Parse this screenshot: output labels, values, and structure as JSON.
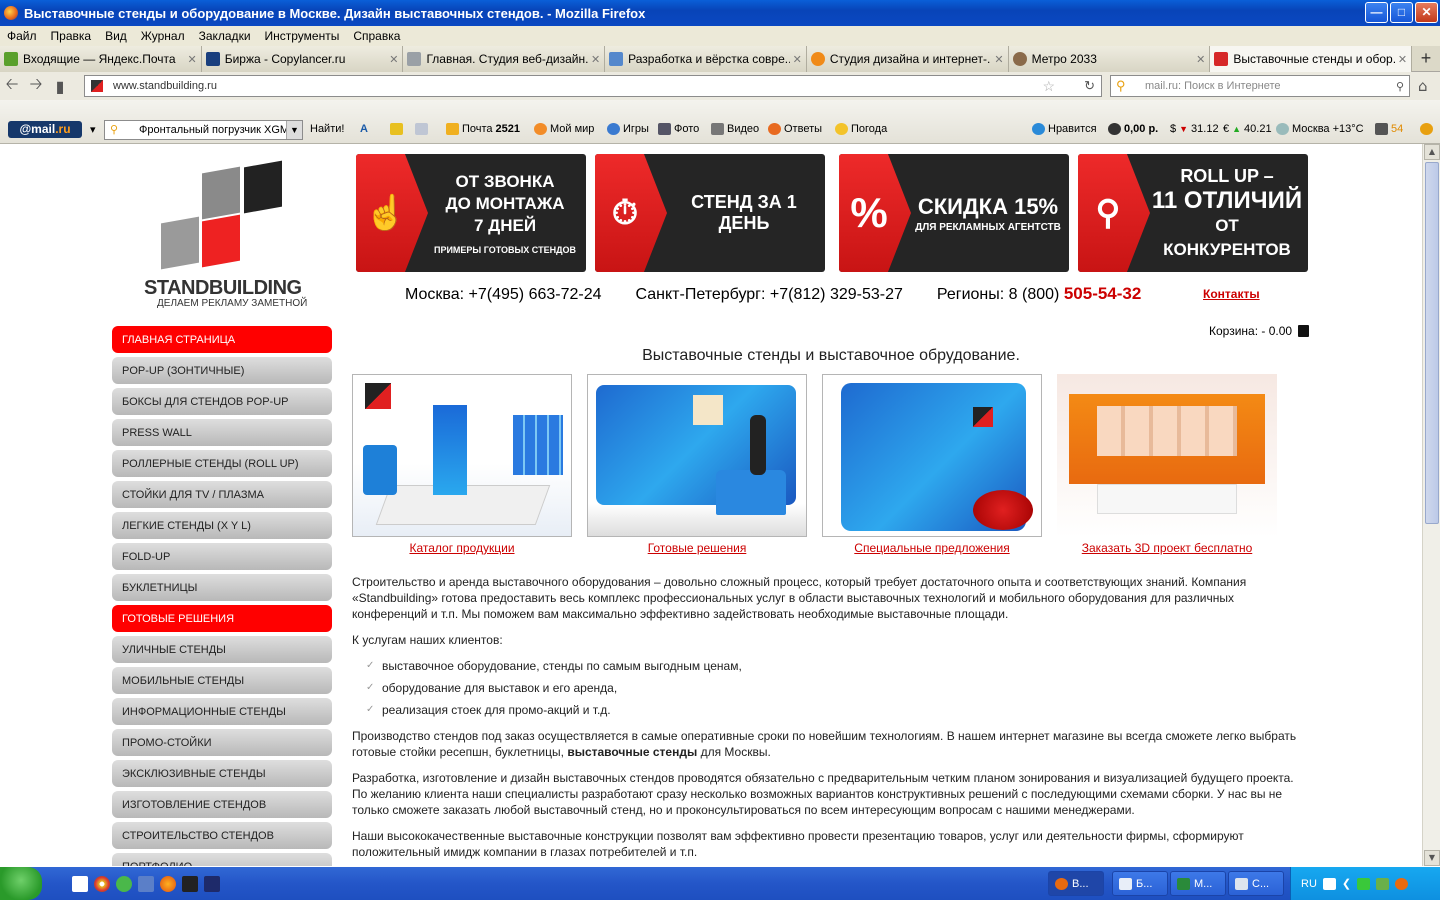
{
  "window": {
    "title": "Выставочные стенды и оборудование в Москве. Дизайн выставочных стендов. - Mozilla Firefox"
  },
  "menu": [
    "Файл",
    "Правка",
    "Вид",
    "Журнал",
    "Закладки",
    "Инструменты",
    "Справка"
  ],
  "tabs": [
    {
      "label": "Входящие — Яндекс.Почта"
    },
    {
      "label": "Биржа - Copylancer.ru"
    },
    {
      "label": "Главная. Студия веб-дизайн..."
    },
    {
      "label": "Разработка и вёрстка совре..."
    },
    {
      "label": "Студия дизайна и интернет-..."
    },
    {
      "label": "Метро 2033"
    },
    {
      "label": "Выставочные стенды и обор..."
    }
  ],
  "nav": {
    "url": "www.standbuilding.ru",
    "search_placeholder": "mail.ru: Поиск в Интернете"
  },
  "mailbar": {
    "logo_a": "@mail",
    "logo_b": ".ru",
    "search_value": "Фронтальный погрузчик XGM",
    "find": "Найти!",
    "mail": "Почта",
    "mail_count": "2521",
    "myworld": "Мой мир",
    "games": "Игры",
    "photo": "Фото",
    "video": "Видео",
    "answers": "Ответы",
    "weather": "Погода",
    "like": "Нравится",
    "balance": "0,00 р.",
    "usd": "31.12",
    "eur": "40.21",
    "city_temp": "Москва +13°C",
    "traffic": "54"
  },
  "site": {
    "brand": "STANDBUILDING",
    "slogan": "ДЕЛАЕМ РЕКЛАМУ ЗАМЕТНОЙ",
    "banners": [
      {
        "l1": "ОТ ЗВОНКА",
        "l2": "ДО МОНТАЖА",
        "l3": "7 ДНЕЙ",
        "l4": "ПРИМЕРЫ ГОТОВЫХ СТЕНДОВ",
        "icon": "hand-icon"
      },
      {
        "l1": "СТЕНД ЗА 1 ДЕНЬ",
        "icon": "stopwatch-icon"
      },
      {
        "l1": "СКИДКА 15%",
        "l2": "ДЛЯ РЕКЛАМНЫХ АГЕНТСТВ",
        "icon": "percent-icon"
      },
      {
        "l1": "ROLL UP –",
        "l2": "11 ОТЛИЧИЙ",
        "l3": "ОТ КОНКУРЕНТОВ",
        "icon": "magnifier-icon"
      }
    ],
    "phones": {
      "moscow_label": "Москва:",
      "moscow": "+7(495) 663-72-24",
      "spb_label": "Санкт-Петербург:",
      "spb": "+7(812) 329-53-27",
      "regions_label": "Регионы:",
      "regions_prefix": "8 (800)",
      "regions_number": "505-54-32"
    },
    "contacts": "Контакты",
    "cart": "Корзина: - 0.00",
    "heading": "Выставочные стенды и выставочное обрудование.",
    "tiles": [
      {
        "label": "Каталог продукции"
      },
      {
        "label": "Готовые решения"
      },
      {
        "label": "Специальные предложения"
      },
      {
        "label": "Заказать 3D проект бесплатно"
      }
    ],
    "sidebar": [
      {
        "label": "ГЛАВНАЯ СТРАНИЦА",
        "active": true
      },
      {
        "label": "POP-UP (ЗОНТИЧНЫЕ)"
      },
      {
        "label": "БОКСЫ ДЛЯ СТЕНДОВ POP-UP"
      },
      {
        "label": "PRESS WALL"
      },
      {
        "label": "РОЛЛЕРНЫЕ СТЕНДЫ (ROLL UP)"
      },
      {
        "label": "СТОЙКИ ДЛЯ TV / ПЛАЗМА"
      },
      {
        "label": "ЛЕГКИЕ СТЕНДЫ (X Y L)"
      },
      {
        "label": "FOLD-UP"
      },
      {
        "label": "БУКЛЕТНИЦЫ"
      },
      {
        "label": "ГОТОВЫЕ РЕШЕНИЯ",
        "active": true
      },
      {
        "label": "УЛИЧНЫЕ СТЕНДЫ"
      },
      {
        "label": "МОБИЛЬНЫЕ СТЕНДЫ"
      },
      {
        "label": "ИНФОРМАЦИОННЫЕ СТЕНДЫ"
      },
      {
        "label": "ПРОМО-СТОЙКИ"
      },
      {
        "label": "ЭКСКЛЮЗИВНЫЕ СТЕНДЫ"
      },
      {
        "label": "ИЗГОТОВЛЕНИЕ СТЕНДОВ"
      },
      {
        "label": "СТРОИТЕЛЬСТВО СТЕНДОВ"
      },
      {
        "label": "ПОРТФОЛИО"
      }
    ],
    "text": {
      "p1": "Строительство и аренда выставочного оборудования – довольно сложный процесс, который требует достаточного опыта и соответствующих знаний. Компания «Standbuilding» готова предоставить весь комплекс профессиональных услуг в области выставочных технологий и мобильного оборудования для различных конференций и т.п. Мы поможем вам максимально эффективно задействовать необходимые выставочные площади.",
      "p2": "К услугам наших клиентов:",
      "list": [
        "выставочное оборудование, стенды по самым выгодным ценам,",
        "оборудование для выставок и его аренда,",
        "реализация стоек для промо-акций и т.д."
      ],
      "p3a": "Производство стендов под заказ осуществляется в самые оперативные сроки по новейшим технологиям. В нашем интернет магазине вы всегда сможете легко выбрать готовые стойки ресепшн, буклетницы,",
      "p3b": "выставочные стенды",
      "p3c": "для Москвы.",
      "p4": "Разработка, изготовление и дизайн выставочных стендов проводятся обязательно с предварительным четким планом зонирования и визуализацией будущего проекта. По желанию клиента наши специалисты разработают сразу несколько возможных вариантов конструктивных решений с последующими схемами сборки. У нас вы не только сможете заказать любой выставочный стенд, но и проконсультироваться по всем интересующим вопросам с нашими менеджерами.",
      "p5": "Наши высококачественные выставочные конструкции позволят вам эффективно провести презентацию товаров, услуг или деятельности фирмы, сформируют положительный имидж компании в глазах потребителей и т.п."
    }
  },
  "taskbar": {
    "buttons": [
      "В...",
      "Б...",
      "М...",
      "С..."
    ],
    "lang": "RU"
  },
  "colors": {
    "accent_red": "#ff0000",
    "link_red": "#cc0000",
    "xp_blue": "#0a48c2"
  }
}
